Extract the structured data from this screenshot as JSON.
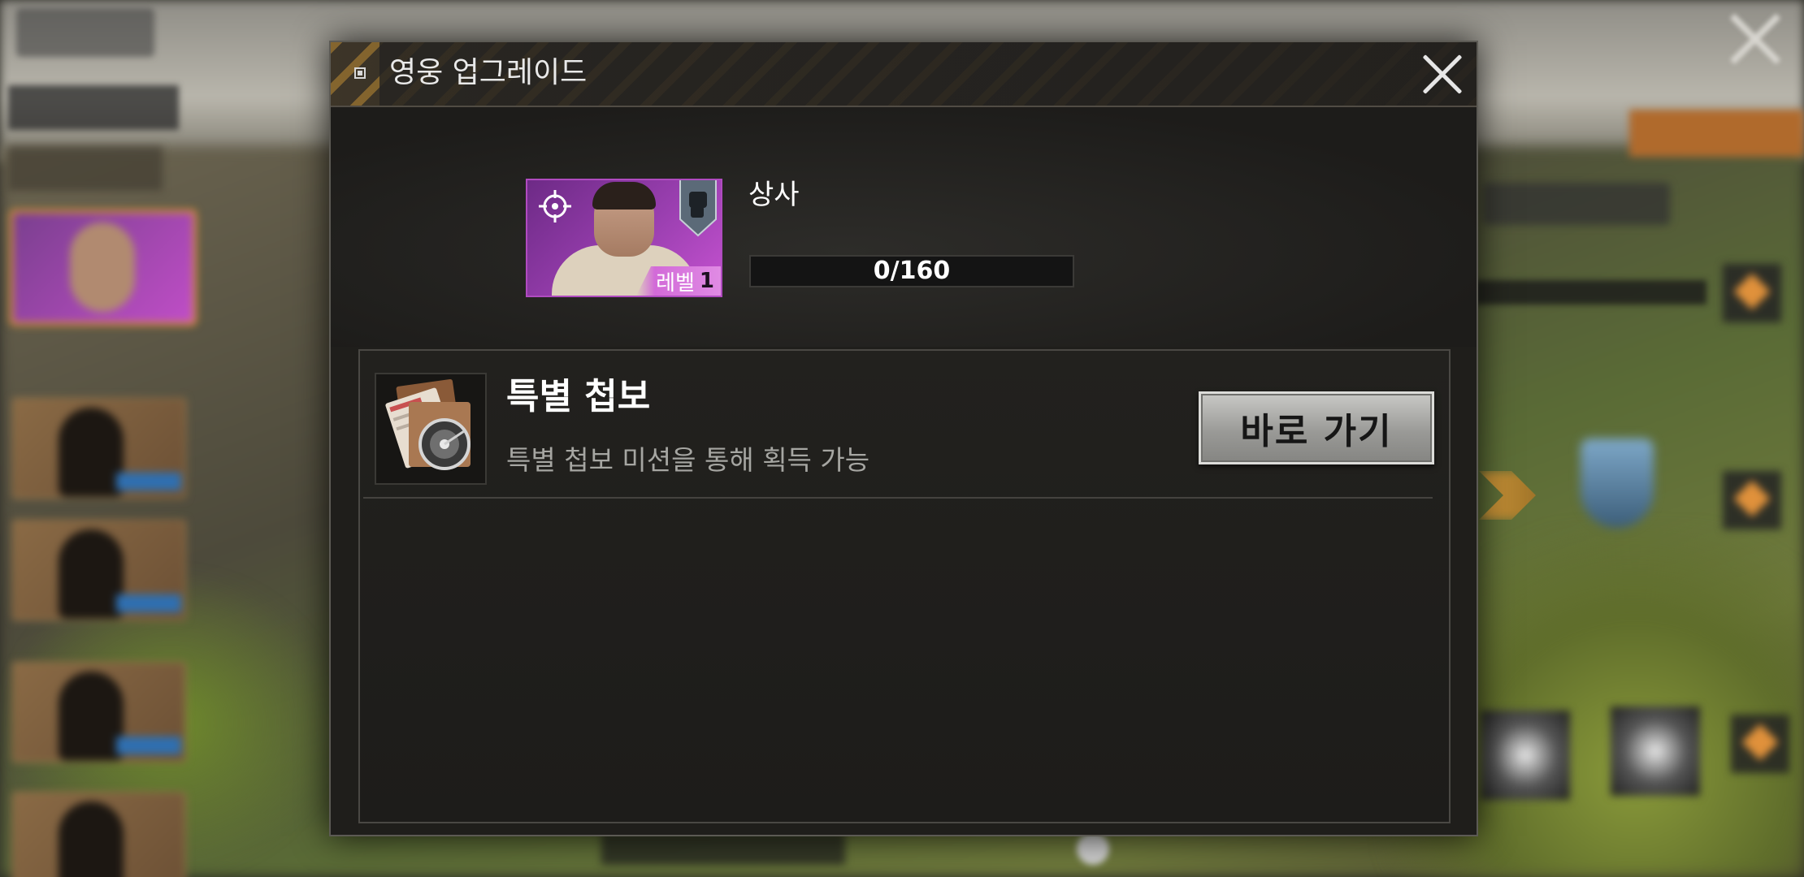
{
  "dialog": {
    "title": "영웅 업그레이드",
    "close_icon": "close-icon"
  },
  "hero": {
    "rank": "상사",
    "level_label": "레벨",
    "level_value": "1",
    "portrait_color": "#9a3fb0",
    "progress": {
      "current": 0,
      "max": 160,
      "text": "0/160"
    }
  },
  "sources": [
    {
      "icon": "intel-documents-icon",
      "title": "특별 첩보",
      "description": "특별 첩보 미션을 통해 획득 가능",
      "button_label": "바로 가기"
    }
  ]
}
